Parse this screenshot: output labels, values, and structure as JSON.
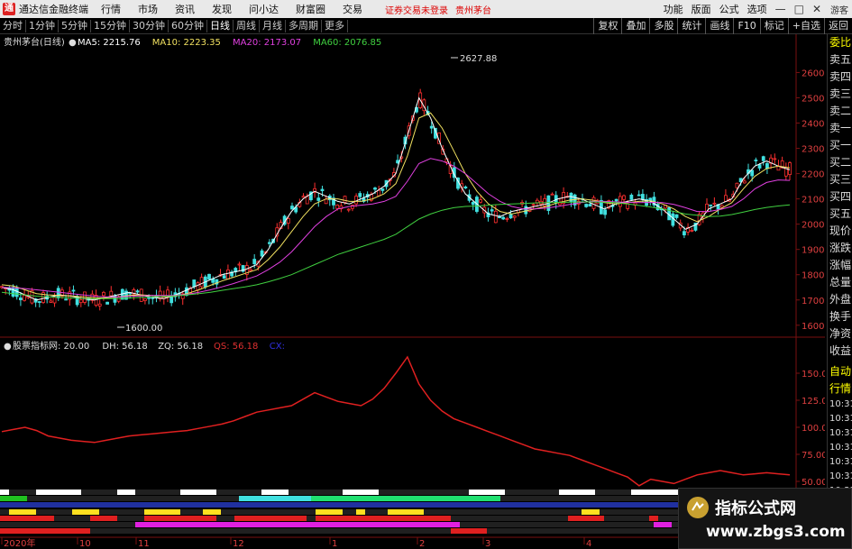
{
  "menubar": {
    "app_title": "通达信金融终端",
    "items": [
      "行情",
      "市场",
      "资讯",
      "发现",
      "问小达",
      "财富圈",
      "交易"
    ],
    "login_status": "证券交易未登录",
    "stock_tag": "贵州茅台",
    "right_items": [
      "功能",
      "版面",
      "公式",
      "选项"
    ],
    "guest": "游客",
    "logo_char": "通"
  },
  "toolbar": {
    "periods": [
      "分时",
      "1分钟",
      "5分钟",
      "15分钟",
      "30分钟",
      "60分钟",
      "日线",
      "周线",
      "月线",
      "多周期",
      "更多"
    ],
    "active_period": "日线",
    "right_tools": [
      "复权",
      "叠加",
      "多股",
      "统计",
      "画线",
      "F10",
      "标记",
      "+自选",
      "返回"
    ]
  },
  "main_chart": {
    "title": "贵州茅台(日线)",
    "ma_labels": [
      {
        "name": "MA5",
        "value": "2215.76",
        "color": "#ffffff"
      },
      {
        "name": "MA10",
        "value": "2223.35",
        "color": "#f0e060"
      },
      {
        "name": "MA20",
        "value": "2173.07",
        "color": "#e040e0"
      },
      {
        "name": "MA60",
        "value": "2076.85",
        "color": "#40d040"
      }
    ],
    "high_label": "2627.88",
    "low_label": "1600.00",
    "y_ticks": [
      "2600",
      "2500",
      "2400",
      "2300",
      "2200",
      "2100",
      "2000",
      "1900",
      "1800",
      "1700",
      "1600"
    ]
  },
  "sub_chart": {
    "title": "股票指标网",
    "params": [
      {
        "text": ": 20.00",
        "color": "#dddddd"
      },
      {
        "text": "DH: 56.18",
        "color": "#dddddd"
      },
      {
        "text": "ZQ: 56.18",
        "color": "#dddddd"
      },
      {
        "text": "QS: 56.18",
        "color": "#e03030"
      },
      {
        "text": "CX:",
        "color": "#3030e0"
      }
    ],
    "y_ticks": [
      "150.00",
      "125.00",
      "100.00",
      "75.00",
      "50.00"
    ]
  },
  "x_axis": {
    "labels": [
      "2020年",
      "10",
      "11",
      "12",
      "1",
      "2",
      "3",
      "4"
    ]
  },
  "side_panel": {
    "items": [
      "委比",
      "卖五",
      "卖四",
      "卖三",
      "卖二",
      "卖一",
      "买一",
      "买二",
      "买三",
      "买四",
      "买五",
      "现价",
      "涨跌",
      "涨幅",
      "总量",
      "外盘",
      "换手",
      "净资",
      "收益"
    ],
    "bottom_items": [
      "自动",
      "行情"
    ],
    "times": [
      "10:31",
      "10:31",
      "10:31",
      "10:31",
      "10:31",
      "10:31",
      "10:31",
      "10:31"
    ]
  },
  "watermark": {
    "title": "指标公式网",
    "url": "www.zbgs3.com"
  },
  "chart_data": {
    "type": "line",
    "description_none": "",
    "price_ylim": [
      1560,
      2680
    ],
    "series": [
      {
        "name": "MA5",
        "values": [
          1750,
          1740,
          1720,
          1700,
          1710,
          1720,
          1715,
          1705,
          1700,
          1710,
          1720,
          1730,
          1720,
          1710,
          1705,
          1720,
          1740,
          1760,
          1780,
          1800,
          1810,
          1820,
          1840,
          1900,
          1980,
          2050,
          2100,
          2130,
          2110,
          2090,
          2080,
          2100,
          2120,
          2150,
          2200,
          2350,
          2500,
          2420,
          2300,
          2200,
          2120,
          2080,
          2040,
          2030,
          2050,
          2060,
          2070,
          2080,
          2100,
          2110,
          2100,
          2080,
          2060,
          2080,
          2090,
          2100,
          2090,
          2060,
          2020,
          1980,
          2000,
          2060,
          2080,
          2100,
          2180,
          2230,
          2250,
          2230,
          2215
        ]
      },
      {
        "name": "MA10",
        "values": [
          1760,
          1755,
          1740,
          1725,
          1720,
          1718,
          1716,
          1712,
          1708,
          1708,
          1712,
          1718,
          1720,
          1718,
          1712,
          1715,
          1725,
          1740,
          1758,
          1775,
          1790,
          1805,
          1820,
          1860,
          1910,
          1970,
          2030,
          2080,
          2100,
          2100,
          2090,
          2090,
          2100,
          2120,
          2160,
          2270,
          2420,
          2440,
          2380,
          2290,
          2200,
          2130,
          2080,
          2050,
          2040,
          2050,
          2060,
          2070,
          2085,
          2095,
          2100,
          2095,
          2085,
          2080,
          2085,
          2090,
          2092,
          2080,
          2060,
          2030,
          2010,
          2030,
          2060,
          2085,
          2140,
          2190,
          2220,
          2230,
          2223
        ]
      },
      {
        "name": "MA20",
        "values": [
          1750,
          1748,
          1745,
          1740,
          1735,
          1730,
          1725,
          1720,
          1715,
          1712,
          1712,
          1714,
          1716,
          1718,
          1718,
          1718,
          1722,
          1730,
          1740,
          1752,
          1765,
          1780,
          1795,
          1820,
          1850,
          1890,
          1940,
          1990,
          2030,
          2060,
          2070,
          2075,
          2080,
          2090,
          2110,
          2170,
          2240,
          2260,
          2250,
          2230,
          2200,
          2160,
          2120,
          2090,
          2070,
          2060,
          2060,
          2064,
          2070,
          2078,
          2085,
          2090,
          2090,
          2088,
          2086,
          2085,
          2086,
          2085,
          2078,
          2065,
          2050,
          2050,
          2058,
          2070,
          2100,
          2140,
          2165,
          2175,
          2173
        ]
      },
      {
        "name": "MA60",
        "values": [
          1730,
          1725,
          1720,
          1715,
          1712,
          1710,
          1708,
          1706,
          1705,
          1705,
          1706,
          1708,
          1710,
          1712,
          1714,
          1716,
          1720,
          1725,
          1730,
          1738,
          1745,
          1752,
          1760,
          1772,
          1785,
          1800,
          1820,
          1840,
          1860,
          1880,
          1895,
          1910,
          1925,
          1940,
          1960,
          1990,
          2020,
          2040,
          2055,
          2065,
          2070,
          2072,
          2075,
          2078,
          2080,
          2082,
          2084,
          2085,
          2086,
          2087,
          2088,
          2088,
          2087,
          2085,
          2080,
          2074,
          2068,
          2060,
          2050,
          2040,
          2035,
          2030,
          2032,
          2038,
          2048,
          2058,
          2066,
          2072,
          2076
        ]
      },
      {
        "name": "QS",
        "values": [
          96,
          98,
          100,
          97,
          92,
          90,
          88,
          87,
          86,
          88,
          90,
          92,
          93,
          94,
          95,
          96,
          97,
          99,
          101,
          103,
          106,
          110,
          114,
          116,
          118,
          120,
          126,
          132,
          128,
          124,
          122,
          120,
          126,
          136,
          150,
          165,
          140,
          125,
          115,
          108,
          104,
          100,
          96,
          92,
          88,
          84,
          80,
          78,
          76,
          74,
          70,
          66,
          62,
          58,
          54,
          46,
          52,
          50,
          48,
          52,
          56,
          58,
          60,
          58,
          56,
          57,
          58,
          57,
          56
        ]
      }
    ],
    "sub_ylim": [
      45,
      170
    ]
  }
}
